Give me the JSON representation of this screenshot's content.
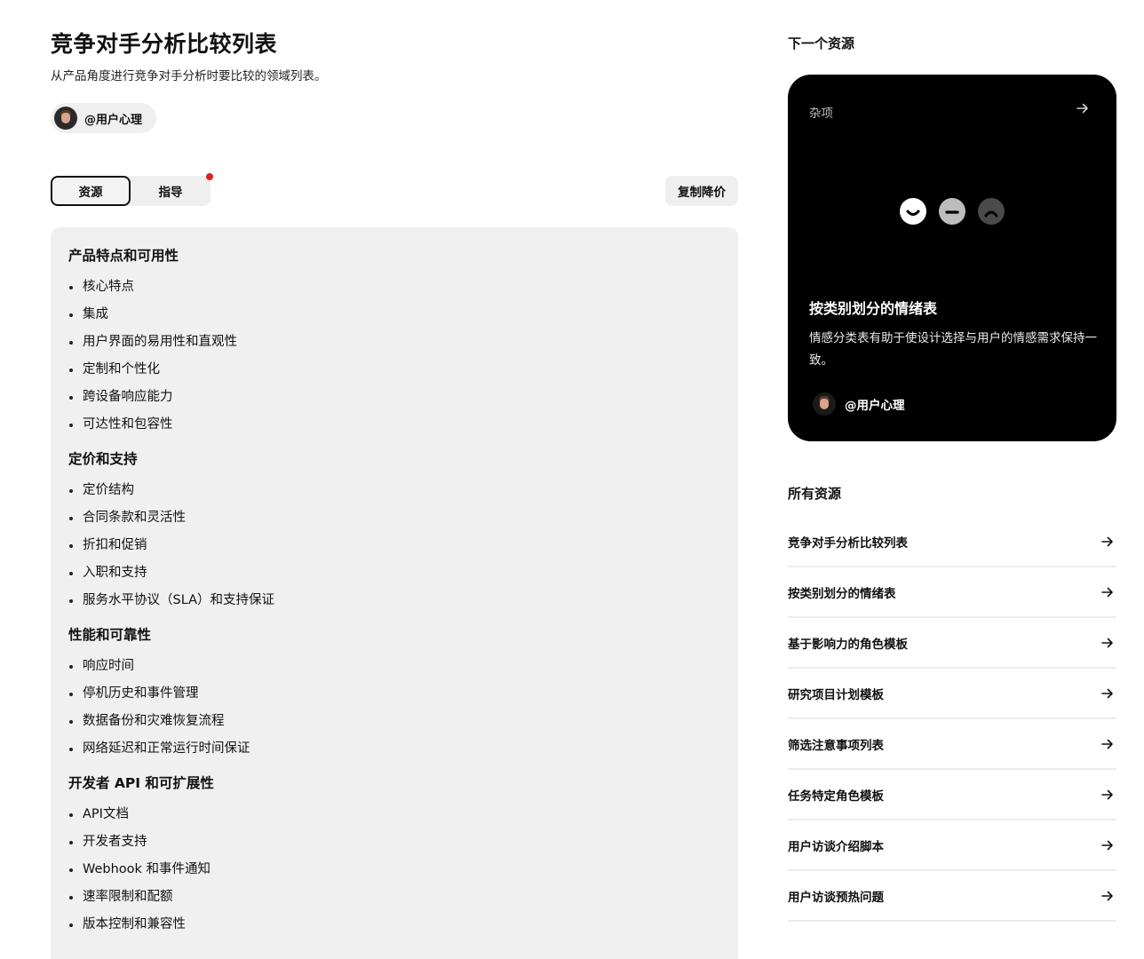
{
  "doc": {
    "title": "竞争对手分析比较列表",
    "subtitle": "从产品角度进行竞争对手分析时要比较的领域列表。",
    "author": "@用户心理"
  },
  "tabs": [
    {
      "label": "资源"
    },
    {
      "label": "指导"
    }
  ],
  "copy_button": "复制降价",
  "sections": [
    {
      "heading": "产品特点和可用性",
      "items": [
        "核心特点",
        "集成",
        "用户界面的易用性和直观性",
        "定制和个性化",
        "跨设备响应能力",
        "可达性和包容性"
      ]
    },
    {
      "heading": "定价和支持",
      "items": [
        "定价结构",
        "合同条款和灵活性",
        "折扣和促销",
        "入职和支持",
        "服务水平协议（SLA）和支持保证"
      ]
    },
    {
      "heading": "性能和可靠性",
      "items": [
        "响应时间",
        "停机历史和事件管理",
        "数据备份和灾难恢复流程",
        "网络延迟和正常运行时间保证"
      ]
    },
    {
      "heading": "开发者 API 和可扩展性",
      "items": [
        "API文档",
        "开发者支持",
        "Webhook 和事件通知",
        "速率限制和配额",
        "版本控制和兼容性"
      ]
    }
  ],
  "next_resource": {
    "heading": "下一个资源",
    "category": "杂项",
    "title": "按类别划分的情绪表",
    "description": "情感分类表有助于使设计选择与用户的情感需求保持一致。",
    "author": "@用户心理"
  },
  "all_resources": {
    "heading": "所有资源",
    "items": [
      "竞争对手分析比较列表",
      "按类别划分的情绪表",
      "基于影响力的角色模板",
      "研究项目计划模板",
      "筛选注意事项列表",
      "任务特定角色模板",
      "用户访谈介绍脚本",
      "用户访谈预热问题"
    ]
  },
  "colors": {
    "accent_dot": "#e02020",
    "card_bg": "#000000",
    "panel_bg": "#f0f0f0"
  }
}
